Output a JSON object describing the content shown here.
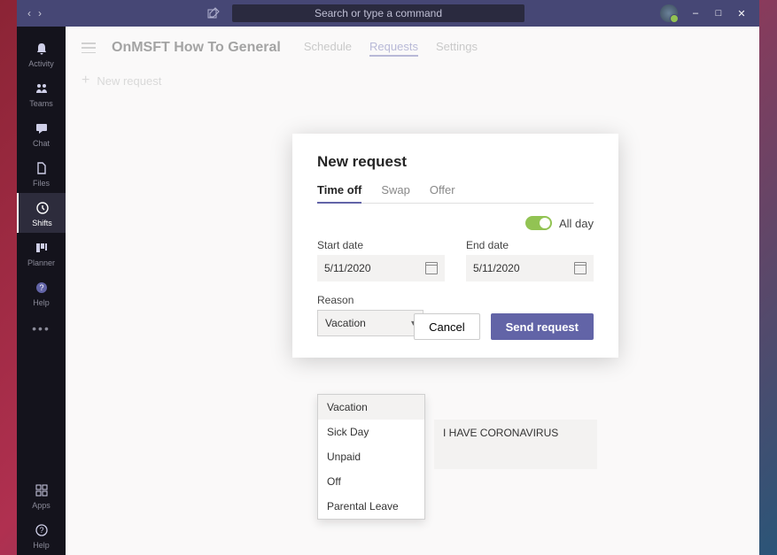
{
  "titlebar": {
    "search_placeholder": "Search or type a command"
  },
  "rail": {
    "items": [
      {
        "label": "Activity"
      },
      {
        "label": "Teams"
      },
      {
        "label": "Chat"
      },
      {
        "label": "Files"
      },
      {
        "label": "Shifts"
      },
      {
        "label": "Planner"
      },
      {
        "label": "Help"
      }
    ],
    "bottom": [
      {
        "label": "Apps"
      },
      {
        "label": "Help"
      }
    ]
  },
  "header": {
    "title": "OnMSFT How To General",
    "tabs": [
      "Schedule",
      "Requests",
      "Settings"
    ],
    "new_request": "New request"
  },
  "modal": {
    "title": "New request",
    "tabs": [
      "Time off",
      "Swap",
      "Offer"
    ],
    "all_day": "All day",
    "start_label": "Start date",
    "start_value": "5/11/2020",
    "end_label": "End date",
    "end_value": "5/11/2020",
    "reason_label": "Reason",
    "reason_value": "Vacation",
    "reason_options": [
      "Vacation",
      "Sick Day",
      "Unpaid",
      "Off",
      "Parental Leave"
    ],
    "note_value": "I HAVE CORONAVIRUS",
    "cancel": "Cancel",
    "send": "Send request"
  }
}
